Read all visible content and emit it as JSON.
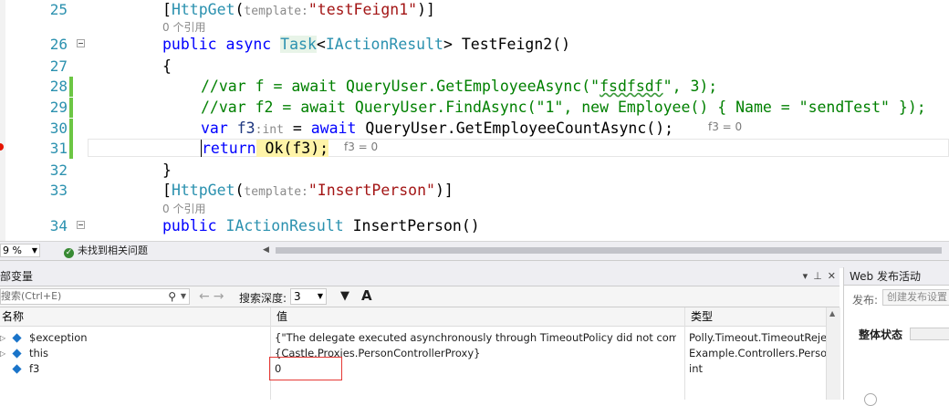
{
  "editor": {
    "lines": [
      {
        "num": "25"
      },
      {
        "num": "26"
      },
      {
        "num": "27"
      },
      {
        "num": "28"
      },
      {
        "num": "29"
      },
      {
        "num": "30"
      },
      {
        "num": "31"
      },
      {
        "num": "32"
      },
      {
        "num": "33"
      },
      {
        "num": "34"
      }
    ],
    "attr1": {
      "prefix": "[",
      "name": "HttpGet",
      "open": "(",
      "param_hint": "template:",
      "value": "\"testFeign1\"",
      "close": ")]"
    },
    "refs1": "0 个引用",
    "sig26": {
      "public": "public",
      "async": "async",
      "task": "Task",
      "lt": "<",
      "iar": "IActionResult",
      "gt": ">",
      "method": " TestFeign2()"
    },
    "brace_open": "{",
    "line28": {
      "a": "//var f = await QueryUser.GetEmployeeAsync(\"",
      "b": "fsdfsdf",
      "c": "\", 3);"
    },
    "line29": "//var f2 = await QueryUser.FindAsync(\"1\", new Employee() { Name = \"sendTest\" });",
    "line30": {
      "var": "var",
      "f3": " f3",
      "type_hint": ":int",
      "eq": " = ",
      "await": "await",
      "rest": " QueryUser.GetEmployeeCountAsync();",
      "tip": "f3 = 0"
    },
    "line31": {
      "return": "return",
      "expr": " Ok(f3);",
      "tip": "f3 = 0"
    },
    "brace_close": "}",
    "attr2": {
      "prefix": "[",
      "name": "HttpGet",
      "open": "(",
      "param_hint": "template:",
      "value": "\"InsertPerson\"",
      "close": ")]"
    },
    "refs2": "0 个引用",
    "sig34": {
      "public": "public",
      "iar": "IActionResult",
      "method": " InsertPerson()"
    }
  },
  "status": {
    "zoom": "9 %",
    "issues": "未找到相关问题"
  },
  "locals": {
    "title": "部变量",
    "search_placeholder": "搜索(Ctrl+E)",
    "depth_label": "搜索深度:",
    "depth_value": "3",
    "font_icon_text": "A",
    "columns": {
      "name": "名称",
      "value": "值",
      "type": "类型"
    },
    "rows": [
      {
        "name": "$exception",
        "value": "{\"The delegate executed asynchronously through TimeoutPolicy did not complete within the timeout.\"}",
        "type": "Polly.Timeout.TimeoutRejectedException",
        "expandable": true
      },
      {
        "name": "this",
        "value": "{Castle.Proxies.PersonControllerProxy}",
        "type": "Example.Controllers.PersonController",
        "expandable": true
      },
      {
        "name": "f3",
        "value": "0",
        "type": "int",
        "expandable": false
      }
    ]
  },
  "web_publish": {
    "title": "Web 发布活动",
    "publish_label": "发布:",
    "publish_placeholder": "创建发布设置",
    "overall_status": "整体状态"
  },
  "colors": {
    "keyword": "#0000ff",
    "type": "#2b91af",
    "string": "#a31515",
    "comment": "#008000",
    "change_bar": "#6cc644",
    "highlight": "#fff4a8",
    "breakpoint": "#e51400",
    "red_box": "#e53935"
  }
}
